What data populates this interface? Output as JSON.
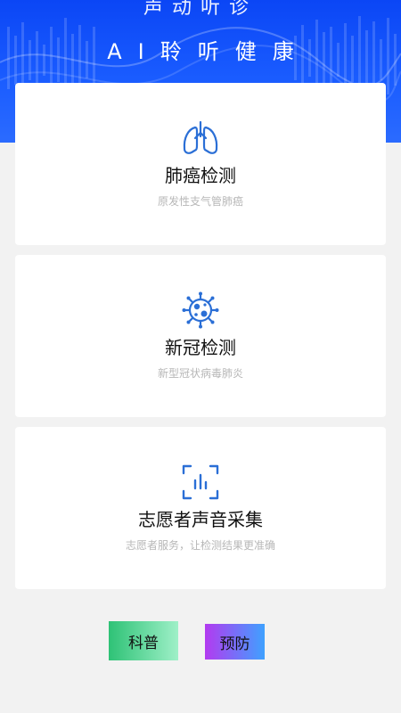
{
  "banner": {
    "top_text": "声动听诊",
    "title": "AI聆听健康"
  },
  "cards": [
    {
      "title": "肺癌检测",
      "subtitle": "原发性支气管肺癌",
      "icon": "lungs-icon"
    },
    {
      "title": "新冠检测",
      "subtitle": "新型冠状病毒肺炎",
      "icon": "virus-icon"
    },
    {
      "title": "志愿者声音采集",
      "subtitle": "志愿者服务，让检测结果更准确",
      "icon": "voice-scan-icon"
    }
  ],
  "buttons": {
    "science": "科普",
    "prevent": "预防"
  },
  "colors": {
    "banner_blue": "#1a5cff",
    "icon_blue": "#2b6fd6",
    "science_gradient": [
      "#2ec276",
      "#9ff0c8"
    ],
    "prevent_gradient": [
      "#b33af0",
      "#3fa1ff"
    ]
  }
}
